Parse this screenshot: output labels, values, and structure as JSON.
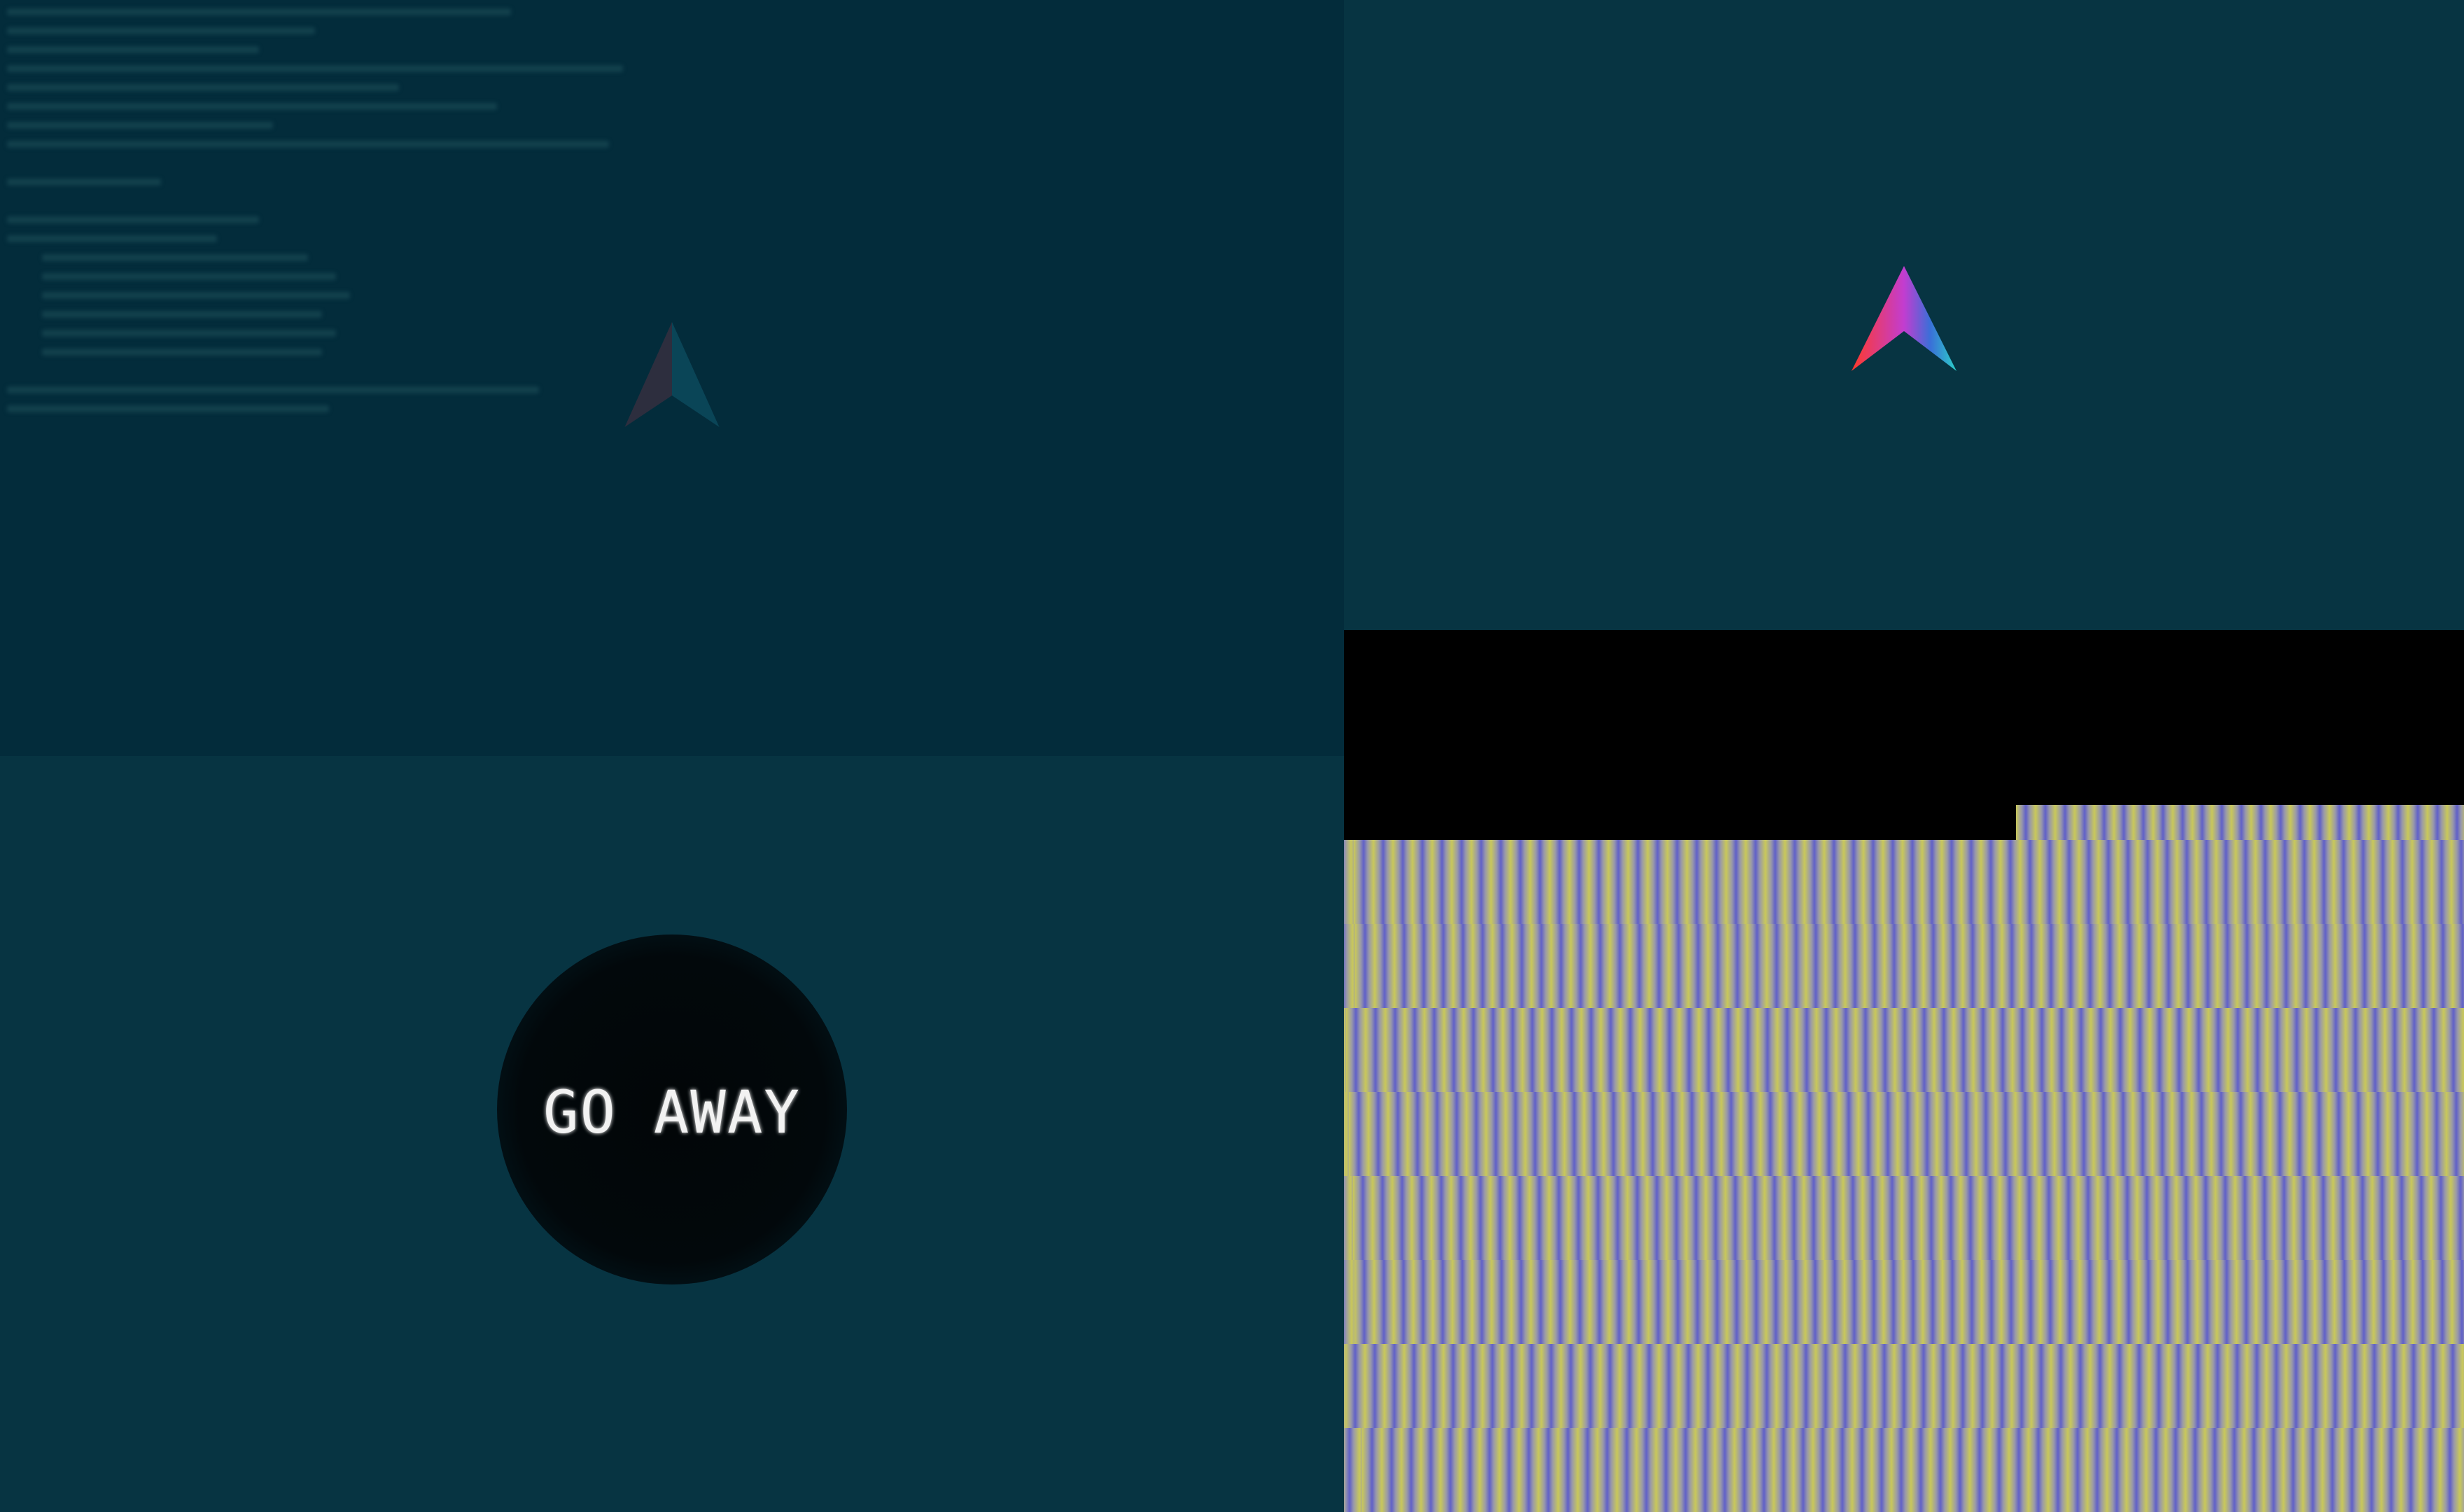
{
  "desktop": {
    "background": "#073442",
    "terminal_background": "#032c3b",
    "logo_icon": "arch-style-triangle-logo-icon",
    "logo_colors": [
      "#e8384f",
      "#3a6fd8",
      "#2bb5d8"
    ]
  },
  "overlay": {
    "label": "GO AWAY"
  },
  "glitch_area": {
    "colors": [
      "#c9c85a",
      "#6060c8",
      "#9a9aa8"
    ]
  }
}
